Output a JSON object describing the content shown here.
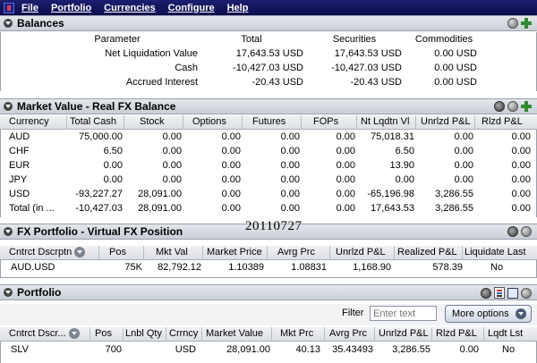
{
  "menu": {
    "file": "File",
    "portfolio": "Portfolio",
    "currencies": "Currencies",
    "configure": "Configure",
    "help": "Help"
  },
  "balances": {
    "title": "Balances",
    "headers": [
      "Parameter",
      "Total",
      "Securities",
      "Commodities"
    ],
    "rows": [
      [
        "Net Liquidation Value",
        "17,643.53 USD",
        "17,643.53 USD",
        "0.00 USD"
      ],
      [
        "Cash",
        "-10,427.03 USD",
        "-10,427.03 USD",
        "0.00 USD"
      ],
      [
        "Accrued Interest",
        "-20.43 USD",
        "-20.43 USD",
        "0.00 USD"
      ]
    ]
  },
  "market_value": {
    "title": "Market Value - Real FX Balance",
    "headers": [
      "Currency",
      "Total Cash",
      "Stock",
      "Options",
      "Futures",
      "FOPs",
      "Nt Lqdtn Vl",
      "Unrlzd P&L",
      "Rlzd P&L"
    ],
    "rows": [
      [
        "AUD",
        "75,000.00",
        "0.00",
        "0.00",
        "0.00",
        "0.00",
        "75,018.31",
        "0.00",
        "0.00"
      ],
      [
        "CHF",
        "6.50",
        "0.00",
        "0.00",
        "0.00",
        "0.00",
        "6.50",
        "0.00",
        "0.00"
      ],
      [
        "EUR",
        "0.00",
        "0.00",
        "0.00",
        "0.00",
        "0.00",
        "13.90",
        "0.00",
        "0.00"
      ],
      [
        "JPY",
        "0.00",
        "0.00",
        "0.00",
        "0.00",
        "0.00",
        "0.00",
        "0.00",
        "0.00"
      ],
      [
        "USD",
        "-93,227.27",
        "28,091.00",
        "0.00",
        "0.00",
        "0.00",
        "-65,196.98",
        "3,286.55",
        "0.00"
      ],
      [
        "Total (in ...",
        "-10,427.03",
        "28,091.00",
        "0.00",
        "0.00",
        "0.00",
        "17,643.53",
        "3,286.55",
        "0.00"
      ]
    ]
  },
  "stamp": "20110727",
  "fx_portfolio": {
    "title": "FX Portfolio - Virtual FX Position",
    "headers": [
      "Cntrct Dscrptn",
      "Pos",
      "Mkt Val",
      "Market Price",
      "Avrg Prc",
      "Unrlzd P&L",
      "Realized P&L",
      "Liquidate Last"
    ],
    "rows": [
      [
        "AUD.USD",
        "75K",
        "82,792.12",
        "1.10389",
        "1.08831",
        "1,168.90",
        "578.39",
        "No"
      ]
    ]
  },
  "portfolio": {
    "title": "Portfolio",
    "filter_label": "Filter",
    "filter_placeholder": "Enter text",
    "more_options": "More options",
    "headers": [
      "Cntrct Dscr...",
      "Pos",
      "Lnbl Qty",
      "Crrncy",
      "Market Value",
      "Mkt Prc",
      "Avrg Prc",
      "Unrlzd P&L",
      "Rlzd P&L",
      "Lqdt Lst"
    ],
    "rows": [
      [
        "SLV",
        "700",
        "",
        "USD",
        "28,091.00",
        "40.13",
        "35.43493",
        "3,286.55",
        "0.00",
        "No"
      ]
    ]
  }
}
